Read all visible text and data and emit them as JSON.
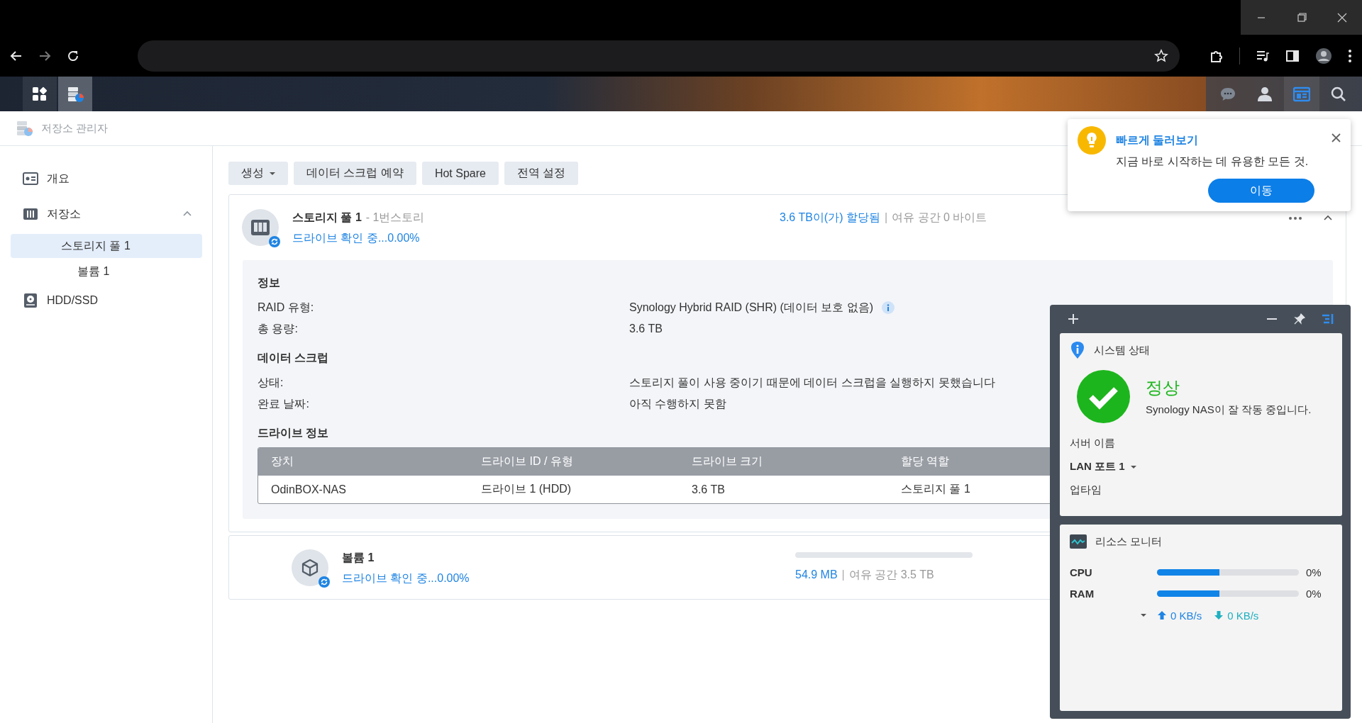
{
  "taskbar": {
    "apps": [
      {
        "kind": "main-menu",
        "selected": false
      },
      {
        "kind": "storage-manager",
        "selected": true
      }
    ],
    "tray": [
      {
        "kind": "chat",
        "selected": false
      },
      {
        "kind": "account",
        "selected": false
      },
      {
        "kind": "widgets",
        "selected": true
      },
      {
        "kind": "search",
        "selected": false
      }
    ]
  },
  "window": {
    "title": "저장소 관리자"
  },
  "sidebar": {
    "items": [
      {
        "kind": "overview",
        "label": "개요",
        "selected": false
      },
      {
        "kind": "storage",
        "label": "저장소",
        "selected": false,
        "expanded": true,
        "children": [
          {
            "label": "스토리지 풀 1",
            "selected": true,
            "children": [
              {
                "label": "볼륨 1",
                "selected": false
              }
            ]
          }
        ]
      },
      {
        "kind": "drive",
        "label": "HDD/SSD",
        "selected": false
      }
    ]
  },
  "toolbar": [
    {
      "label": "생성",
      "kind": "dropdown"
    },
    {
      "label": "데이터 스크럽 예약",
      "kind": "plain"
    },
    {
      "label": "Hot Spare",
      "kind": "plain"
    },
    {
      "label": "전역 설정",
      "kind": "plain"
    }
  ],
  "storage_pool": {
    "title": "스토리지 풀 1",
    "subtitle": "- 1번스토리",
    "status": "드라이브 확인 중...0.00%",
    "allocated": "3.6 TB이(가) 할당됨",
    "separator": "|",
    "free": "여유 공간 0 바이트",
    "expanded": true,
    "sections": [
      {
        "heading": "정보",
        "rows": [
          {
            "label": "RAID 유형:",
            "value": "Synology Hybrid RAID (SHR) (데이터 보호 없음)",
            "info": true
          },
          {
            "label": "총 용량:",
            "value": "3.6 TB",
            "info": false
          }
        ]
      },
      {
        "heading": "데이터 스크럽",
        "rows": [
          {
            "label": "상태:",
            "value": "스토리지 풀이 사용 중이기 때문에 데이터 스크럽을 실행하지 못했습니다",
            "info": false
          },
          {
            "label": "완료 날짜:",
            "value": "아직 수행하지 못함",
            "info": false
          }
        ]
      }
    ],
    "drives": {
      "heading": "드라이브 정보",
      "columns": [
        "장치",
        "드라이브 ID / 유형",
        "드라이브 크기",
        "할당 역할"
      ],
      "rows": [
        [
          "OdinBOX-NAS",
          "드라이브 1 (HDD)",
          "3.6 TB",
          "스토리지 풀 1"
        ]
      ]
    }
  },
  "volume": {
    "title": "볼륨 1",
    "status": "드라이브 확인 중...0.00%",
    "level": 0,
    "used": "54.9 MB",
    "separator": "|",
    "free": "여유 공간 3.5 TB"
  },
  "quick_tour": {
    "title": "빠르게 둘러보기",
    "message": "지금 바로 시작하는 데 유용한 모든 것.",
    "button": "이동"
  },
  "widgets": {
    "system_status": {
      "title": "시스템 상태",
      "state": "정상",
      "message": "Synology NAS이 잘 작동 중입니다.",
      "rows": [
        {
          "label": "서버 이름",
          "kind": "plain"
        },
        {
          "label": "LAN 포트 1",
          "kind": "dropdown"
        },
        {
          "label": "업타임",
          "kind": "plain"
        }
      ]
    },
    "resource_monitor": {
      "title": "리소스 모니터",
      "meters": [
        {
          "name": "CPU",
          "level": 0.44,
          "reading": "0%"
        },
        {
          "name": "RAM",
          "level": 0.44,
          "reading": "0%"
        }
      ],
      "upload": "0 KB/s",
      "download": "0 KB/s"
    }
  }
}
